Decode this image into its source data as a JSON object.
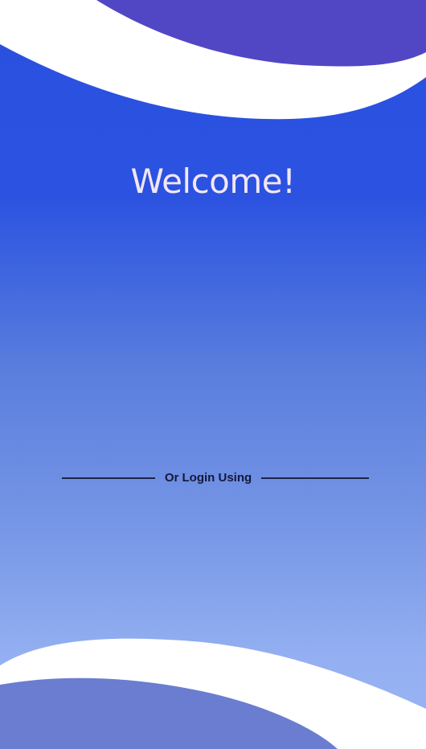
{
  "screen": {
    "title": "Welcome!",
    "divider_label": "Or Login Using"
  },
  "colors": {
    "background_top": "#2a50e0",
    "background_bottom": "#98b4f4",
    "top_wave": "#5147c4",
    "bottom_wave": "#6a7dd0",
    "band": "#ffffff",
    "title_text": "#f2e6f6",
    "divider": "#1d2447"
  }
}
